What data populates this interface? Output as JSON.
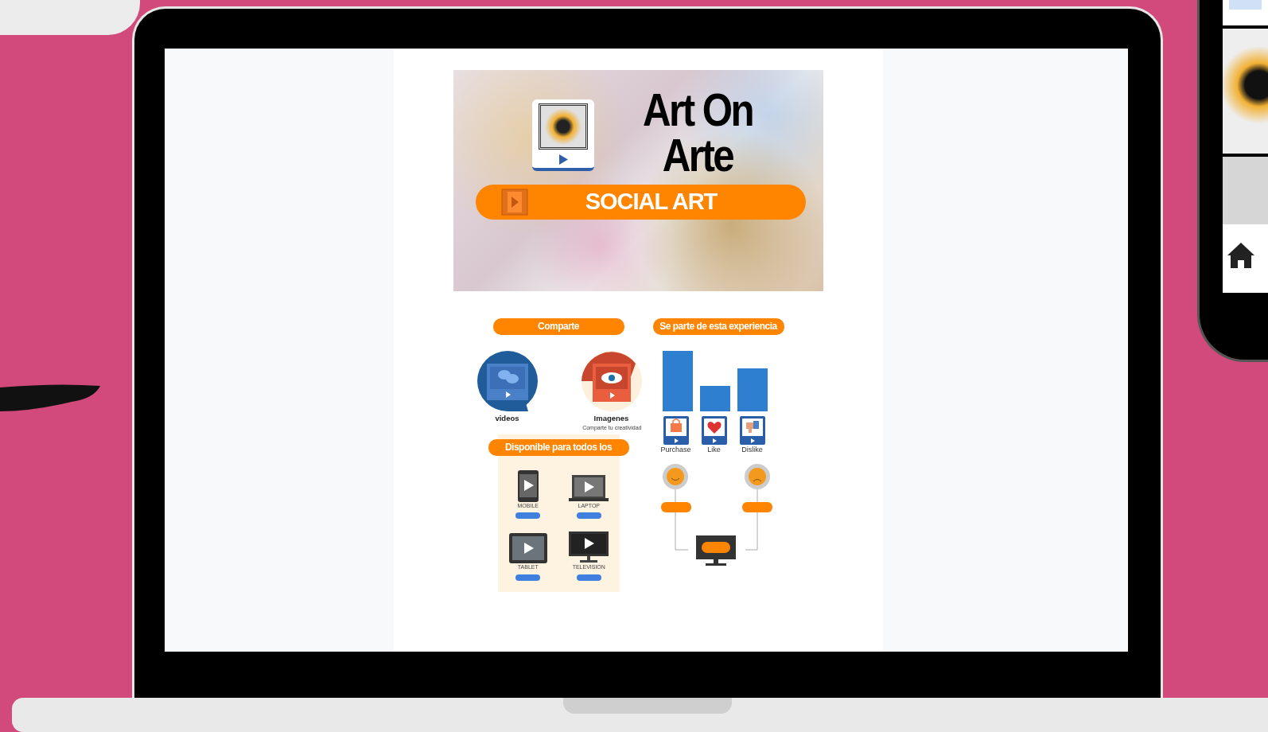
{
  "banner": {
    "title_line_1": "Art On",
    "title_line_2": "Arte",
    "ribbon": "SOCIAL ART"
  },
  "share": {
    "heading": "Comparte",
    "items": [
      {
        "label": "videos",
        "kind": "chat"
      },
      {
        "label": "Imagenes",
        "kind": "eye"
      }
    ],
    "caption": "Comparte tu creatividad"
  },
  "devices": {
    "heading": "Disponible para todos los",
    "items": [
      {
        "label": "MOBILE",
        "kind": "mobile"
      },
      {
        "label": "LAPTOP",
        "kind": "laptop"
      },
      {
        "label": "TABLET",
        "kind": "tablet"
      },
      {
        "label": "TELEVISION",
        "kind": "tv"
      }
    ]
  },
  "experience": {
    "heading": "Se parte de esta experiencia",
    "reactions": [
      {
        "label": "Purchase",
        "kind": "bag"
      },
      {
        "label": "Like",
        "kind": "heart"
      },
      {
        "label": "Dislike",
        "kind": "thumb"
      }
    ]
  }
}
